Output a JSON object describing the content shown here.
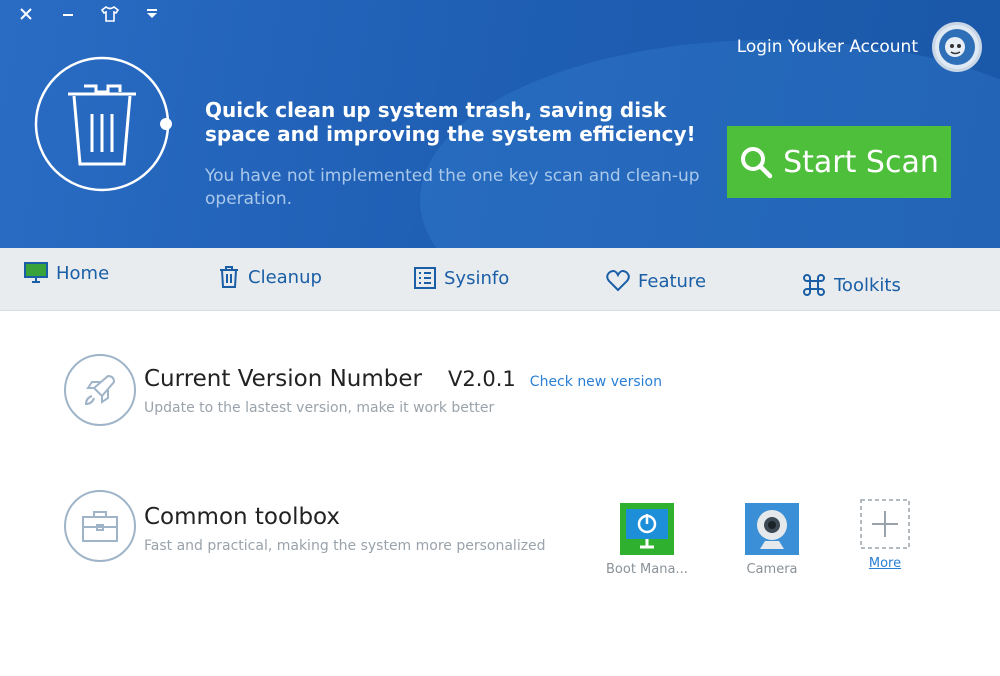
{
  "header": {
    "login_label": "Login Youker Account",
    "headline": "Quick clean up system trash, saving disk space and improving the system efficiency!",
    "subline": "You have not implemented the one key scan and clean-up operation.",
    "scan_button": "Start Scan"
  },
  "tabs": [
    {
      "label": "Home",
      "icon": "monitor-icon"
    },
    {
      "label": "Cleanup",
      "icon": "trash-icon"
    },
    {
      "label": "Sysinfo",
      "icon": "list-icon"
    },
    {
      "label": "Feature",
      "icon": "heart-icon"
    },
    {
      "label": "Toolkits",
      "icon": "command-icon"
    }
  ],
  "version_section": {
    "title": "Current Version Number",
    "version": "V2.0.1",
    "check_link": "Check new version",
    "subtitle": "Update to the lastest version, make it work better"
  },
  "toolbox_section": {
    "title": "Common toolbox",
    "subtitle": "Fast and practical, making the system more personalized",
    "tools": [
      {
        "label": "Boot Mana...",
        "icon": "boot-manager-icon"
      },
      {
        "label": "Camera",
        "icon": "camera-icon"
      },
      {
        "label": "More",
        "icon": "plus-icon"
      }
    ]
  },
  "colors": {
    "header_blue": "#1f5fb4",
    "scan_green": "#4ebf3b",
    "tab_text": "#1a5ea6",
    "link_blue": "#2a7fd4"
  }
}
